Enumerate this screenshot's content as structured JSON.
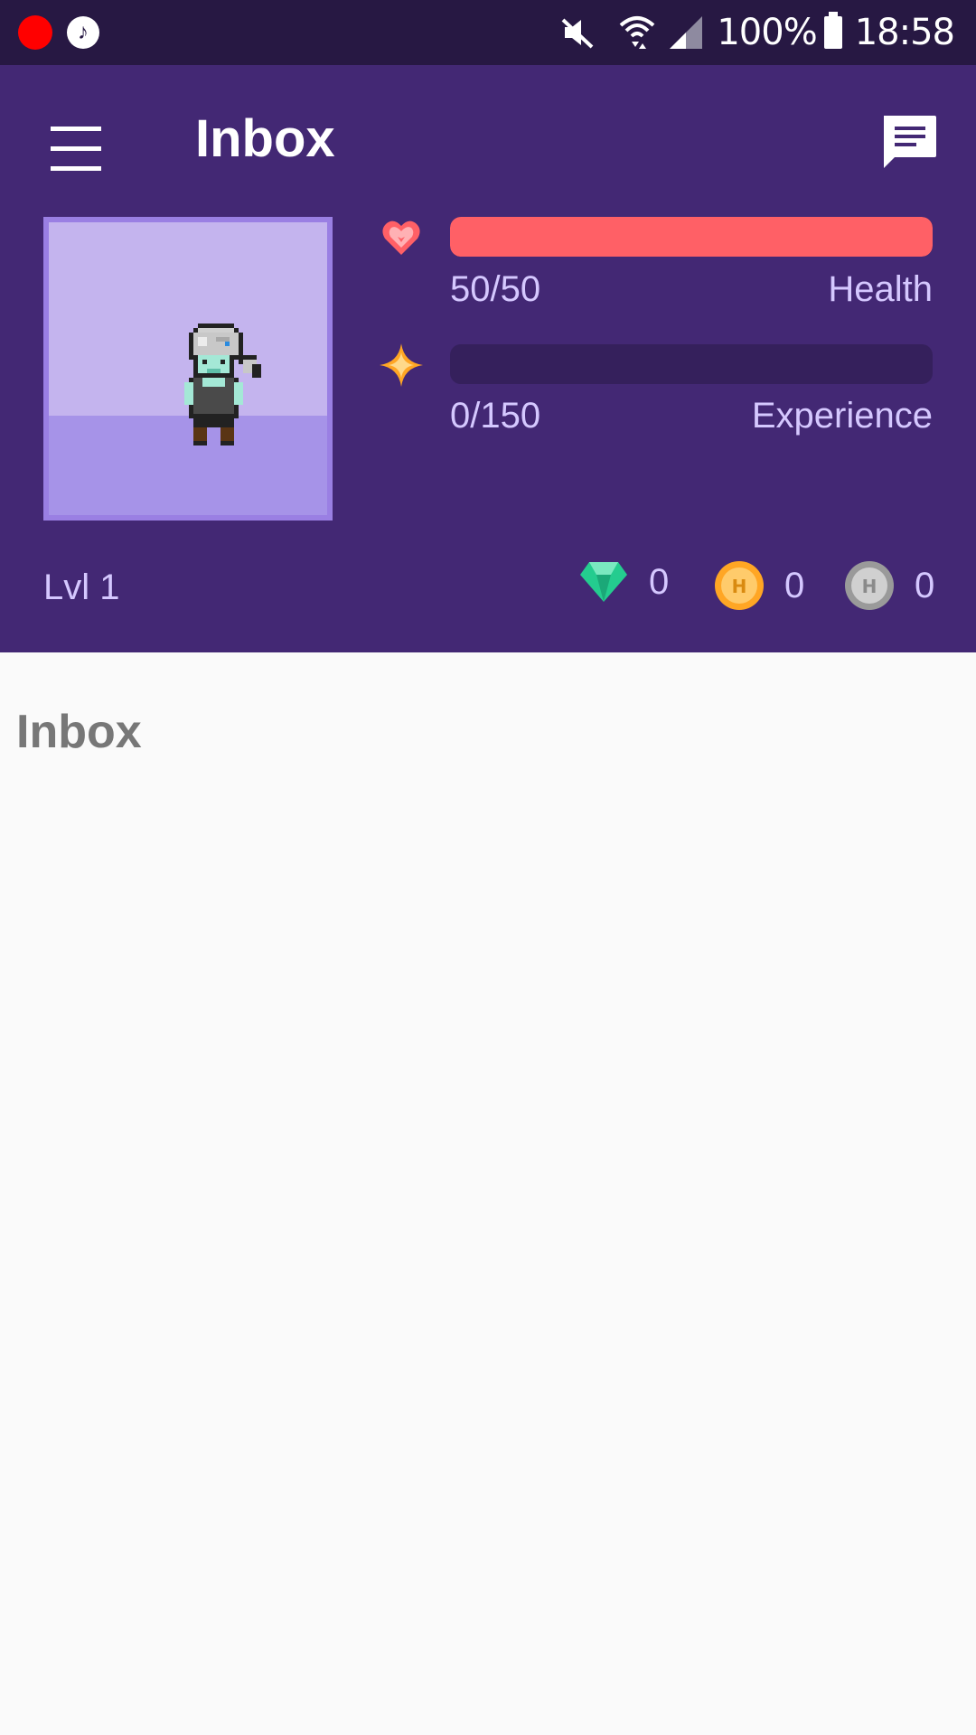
{
  "status_bar": {
    "battery": "100%",
    "time": "18:58",
    "icons": [
      "recording-icon",
      "music-icon",
      "mute-icon",
      "wifi-icon",
      "signal-icon",
      "battery-icon"
    ]
  },
  "header": {
    "title": "Inbox",
    "menu_icon": "hamburger-menu-icon",
    "chat_icon": "chat-icon"
  },
  "stats": {
    "health": {
      "value": "50/50",
      "label": "Health",
      "fraction": 1.0,
      "color": "#ff6066",
      "icon": "heart-icon"
    },
    "experience": {
      "value": "0/150",
      "label": "Experience",
      "fraction": 0.0,
      "color": "#ffa624",
      "icon": "star-icon"
    }
  },
  "level": "Lvl 1",
  "currencies": [
    {
      "icon": "gem-icon",
      "count": "0",
      "color": "#24cc8f"
    },
    {
      "icon": "gold-coin-icon",
      "count": "0",
      "color": "#ffa624"
    },
    {
      "icon": "silver-coin-icon",
      "count": "0",
      "color": "#b2b2b2"
    }
  ],
  "content": {
    "heading": "Inbox"
  },
  "colors": {
    "header_bg": "#432874",
    "status_bg": "#271843",
    "page_bg": "#fafafa"
  }
}
